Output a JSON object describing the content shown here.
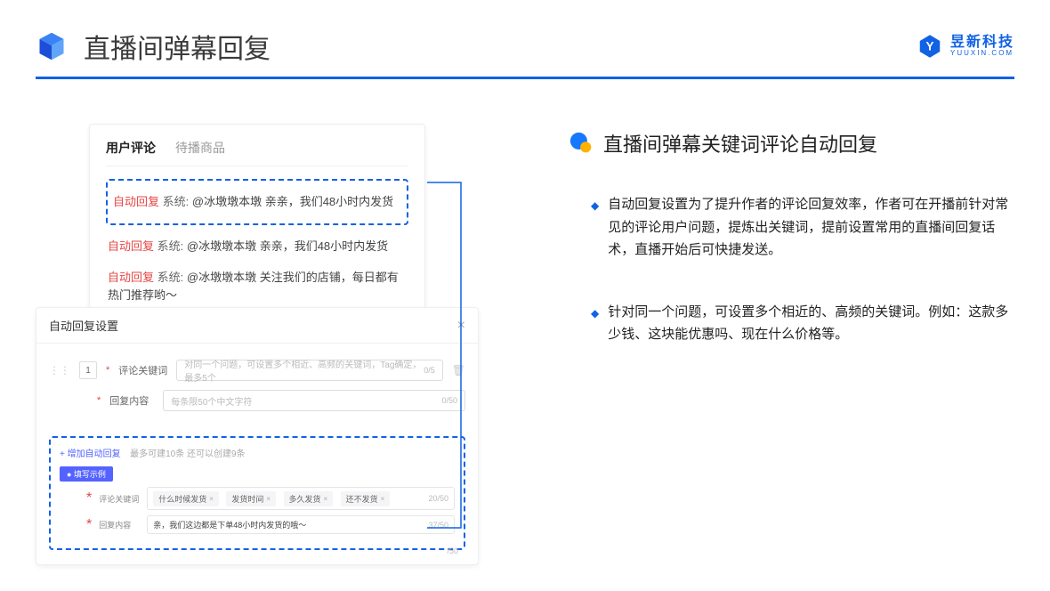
{
  "header": {
    "title": "直播间弹幕回复",
    "brand_main": "昱新科技",
    "brand_sub": "YUUXIN.COM"
  },
  "comments_card": {
    "tab_active": "用户评论",
    "tab_inactive": "待播商品",
    "row1_tag": "自动回复",
    "row1_sys": "系统:",
    "row1_text": "@冰墩墩本墩 亲亲，我们48小时内发货",
    "row2_tag": "自动回复",
    "row2_sys": "系统:",
    "row2_text": "@冰墩墩本墩 亲亲，我们48小时内发货",
    "row3_tag": "自动回复",
    "row3_sys": "系统:",
    "row3_text": "@冰墩墩本墩 关注我们的店铺，每日都有热门推荐哟～"
  },
  "settings_card": {
    "title": "自动回复设置",
    "idx": "1",
    "label_keyword": "评论关键词",
    "placeholder_keyword": "对同一个问题，可设置多个相近、高频的关键词，Tag确定，最多5个",
    "counter_keyword": "0/5",
    "label_content": "回复内容",
    "placeholder_content": "每条限50个中文字符",
    "counter_content": "0/50",
    "add_link": "+ 增加自动回复",
    "add_hint": "最多可建10条 还可以创建9条",
    "example_badge": "● 填写示例",
    "ex_label_keyword": "评论关键词",
    "ex_tag1": "什么时候发货",
    "ex_tag2": "发货时间",
    "ex_tag3": "多久发货",
    "ex_tag4": "还不发货",
    "ex_counter_keyword": "20/50",
    "ex_label_content": "回复内容",
    "ex_content_value": "亲，我们这边都是下单48小时内发货的哦～",
    "ex_counter_content": "37/50",
    "over_counter": "/50"
  },
  "right": {
    "section_title": "直播间弹幕关键词评论自动回复",
    "bullet1": "自动回复设置为了提升作者的评论回复效率，作者可在开播前针对常见的评论用户问题，提炼出关键词，提前设置常用的直播间回复话术，直播开始后可快捷发送。",
    "bullet2": "针对同一个问题，可设置多个相近的、高频的关键词。例如：这款多少钱、这块能优惠吗、现在什么价格等。"
  }
}
